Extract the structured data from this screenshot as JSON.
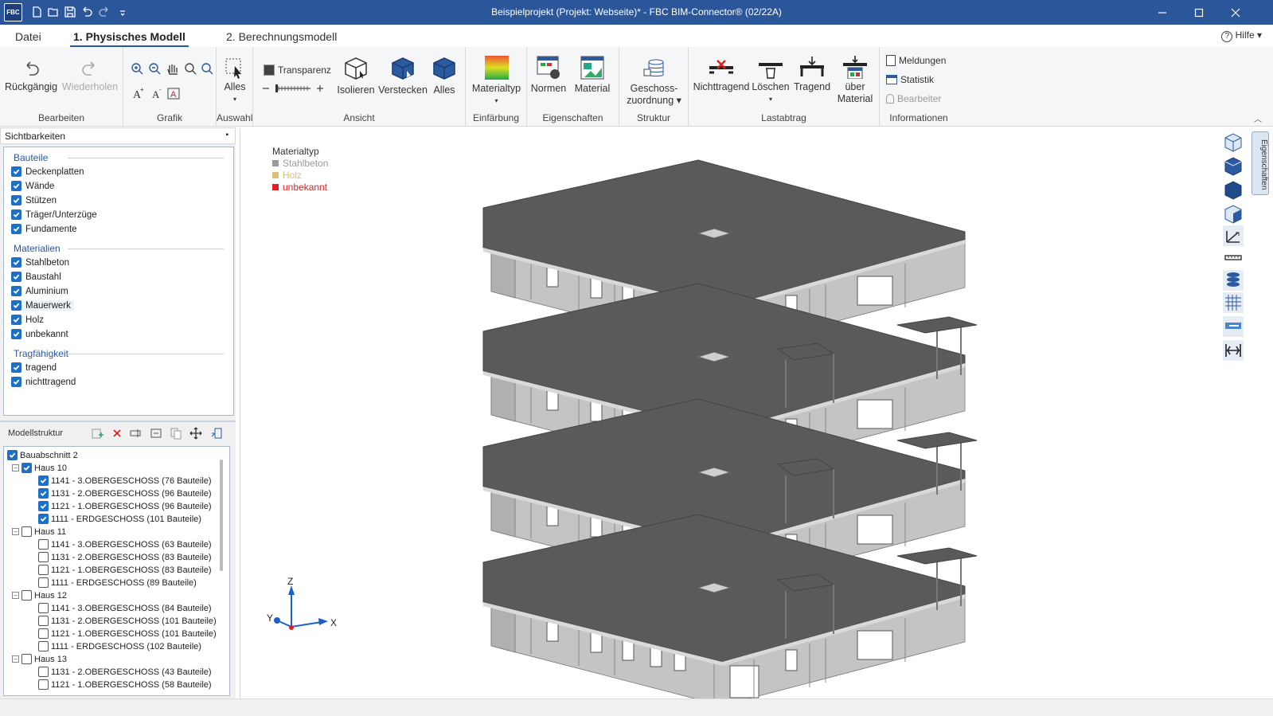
{
  "window": {
    "title": "Beispielprojekt (Projekt: Webseite)*  -  FBC BIM-Connector® (02/22A)",
    "app_icon": "FBC"
  },
  "menu": {
    "tabs": [
      {
        "label": "Datei"
      },
      {
        "label": "1. Physisches Modell"
      },
      {
        "label": "2. Berechnungsmodell"
      }
    ],
    "help": "Hilfe"
  },
  "ribbon": {
    "bearbeiten": {
      "label": "Bearbeiten",
      "undo": "Rückgängig",
      "redo": "Wiederholen"
    },
    "grafik": {
      "label": "Grafik"
    },
    "auswahl": {
      "label": "Auswahl",
      "alles": "Alles"
    },
    "ansicht": {
      "label": "Ansicht",
      "transparenz": "Transparenz",
      "isolieren": "Isolieren",
      "verstecken": "Verstecken",
      "alles": "Alles"
    },
    "einfaerbung": {
      "label": "Einfärbung",
      "materialtyp": "Materialtyp"
    },
    "eigenschaften": {
      "label": "Eigenschaften",
      "normen": "Normen",
      "material": "Material"
    },
    "struktur": {
      "label": "Struktur",
      "geschoss1": "Geschoss-",
      "geschoss2": "zuordnung"
    },
    "lastabtrag": {
      "label": "Lastabtrag",
      "nichttragend": "Nichttragend",
      "loeschen": "Löschen",
      "tragend": "Tragend",
      "ueber1": "über",
      "ueber2": "Material"
    },
    "informationen": {
      "label": "Informationen",
      "meldungen": "Meldungen",
      "statistik": "Statistik",
      "bearbeiter": "Bearbeiter"
    }
  },
  "sidebar": {
    "title": "Sichtbarkeiten",
    "bauteile": {
      "label": "Bauteile",
      "items": [
        "Deckenplatten",
        "Wände",
        "Stützen",
        "Träger/Unterzüge",
        "Fundamente"
      ]
    },
    "materialien": {
      "label": "Materialien",
      "items": [
        "Stahlbeton",
        "Baustahl",
        "Aluminium",
        "Mauerwerk",
        "Holz",
        "unbekannt"
      ]
    },
    "tragfaehigkeit": {
      "label": "Tragfähigkeit",
      "items": [
        "tragend",
        "nichttragend"
      ]
    }
  },
  "modellstruktur": {
    "title": "Modellstruktur",
    "root": "Bauabschnitt 2",
    "nodes": [
      "Haus 10",
      "1141 - 3.OBERGESCHOSS (76 Bauteile)",
      "1131 - 2.OBERGESCHOSS (96 Bauteile)",
      "1121 - 1.OBERGESCHOSS (96 Bauteile)",
      "1111 - ERDGESCHOSS (101 Bauteile)",
      "Haus 11",
      "1141 - 3.OBERGESCHOSS (63 Bauteile)",
      "1131 - 2.OBERGESCHOSS (83 Bauteile)",
      "1121 - 1.OBERGESCHOSS (83 Bauteile)",
      "1111 - ERDGESCHOSS (89 Bauteile)",
      "Haus 12",
      "1141 - 3.OBERGESCHOSS (84 Bauteile)",
      "1131 - 2.OBERGESCHOSS (101 Bauteile)",
      "1121 - 1.OBERGESCHOSS (101 Bauteile)",
      "1111 - ERDGESCHOSS (102 Bauteile)",
      "Haus 13",
      "1131 - 2.OBERGESCHOSS (43 Bauteile)",
      "1121 - 1.OBERGESCHOSS (58 Bauteile)"
    ]
  },
  "viewport": {
    "legend": {
      "title": "Materialtyp",
      "items": [
        {
          "label": "Stahlbeton",
          "color": "#9a9a9a"
        },
        {
          "label": "Holz",
          "color": "#d8c07a"
        },
        {
          "label": "unbekannt",
          "color": "#e02020"
        }
      ]
    },
    "axes": {
      "z": "Z",
      "y": "Y",
      "x": "X"
    }
  },
  "right_panel": {
    "tab": "Eigenschaften"
  },
  "colors": {
    "accent": "#2b579a",
    "checkbox": "#1f6fc5",
    "slab": "#5c5c5c",
    "wall": "#bdbdbd"
  }
}
